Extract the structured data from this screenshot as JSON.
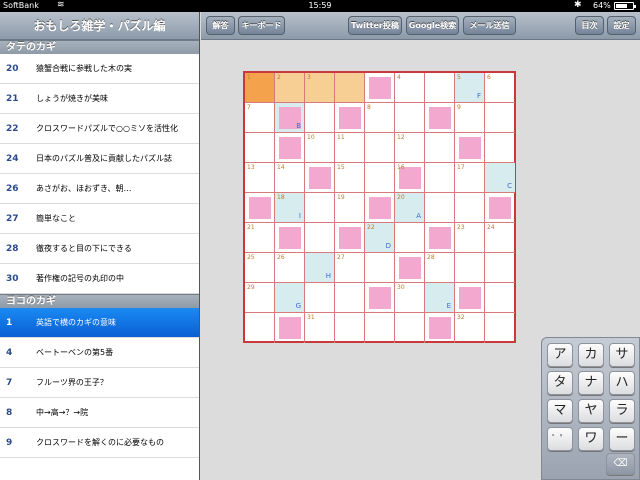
{
  "status": {
    "carrier": "SoftBank",
    "time": "15:59",
    "battery": "64%"
  },
  "sidebar": {
    "title": "おもしろ雑学・パズル編",
    "down_header": "タテのカギ",
    "down": [
      {
        "num": "20",
        "text": "猿蟹合戦に参戦した木の実"
      },
      {
        "num": "21",
        "text": "しょうが焼きが美味"
      },
      {
        "num": "22",
        "text": "クロスワードパズルで○○ミソを活性化"
      },
      {
        "num": "24",
        "text": "日本のパズル普及に貢献したパズル誌"
      },
      {
        "num": "26",
        "text": "あさがお、ほおずき、朝…"
      },
      {
        "num": "27",
        "text": "簡単なこと"
      },
      {
        "num": "28",
        "text": "徹夜すると目の下にできる"
      },
      {
        "num": "30",
        "text": "著作権の記号の丸印の中"
      }
    ],
    "across_header": "ヨコのカギ",
    "across": [
      {
        "num": "1",
        "text": "英語で横のカギの意味"
      },
      {
        "num": "4",
        "text": "ベートーベンの第5番"
      },
      {
        "num": "7",
        "text": "フルーツ界の王子？"
      },
      {
        "num": "8",
        "text": "中→高→？→院"
      },
      {
        "num": "9",
        "text": "クロスワードを解くのに必要なもの"
      }
    ]
  },
  "toolbar": {
    "answer": "解答",
    "keyboard": "キーボード",
    "twitter": "Twitter投稿",
    "google": "Google検索",
    "mail": "メール送信",
    "contents": "目次",
    "settings": "設定"
  },
  "grid": {
    "numbers": [
      {
        "r": 0,
        "c": 0,
        "n": "1"
      },
      {
        "r": 0,
        "c": 1,
        "n": "2"
      },
      {
        "r": 0,
        "c": 2,
        "n": "3"
      },
      {
        "r": 0,
        "c": 5,
        "n": "4"
      },
      {
        "r": 0,
        "c": 7,
        "n": "5"
      },
      {
        "r": 0,
        "c": 8,
        "n": "6"
      },
      {
        "r": 1,
        "c": 0,
        "n": "7"
      },
      {
        "r": 1,
        "c": 4,
        "n": "8"
      },
      {
        "r": 1,
        "c": 7,
        "n": "9"
      },
      {
        "r": 2,
        "c": 2,
        "n": "10"
      },
      {
        "r": 2,
        "c": 3,
        "n": "11"
      },
      {
        "r": 2,
        "c": 5,
        "n": "12"
      },
      {
        "r": 3,
        "c": 0,
        "n": "13"
      },
      {
        "r": 3,
        "c": 1,
        "n": "14"
      },
      {
        "r": 3,
        "c": 3,
        "n": "15"
      },
      {
        "r": 3,
        "c": 5,
        "n": "16"
      },
      {
        "r": 3,
        "c": 7,
        "n": "17"
      },
      {
        "r": 4,
        "c": 1,
        "n": "18"
      },
      {
        "r": 4,
        "c": 3,
        "n": "19"
      },
      {
        "r": 4,
        "c": 5,
        "n": "20"
      },
      {
        "r": 5,
        "c": 0,
        "n": "21"
      },
      {
        "r": 5,
        "c": 4,
        "n": "22"
      },
      {
        "r": 5,
        "c": 7,
        "n": "23"
      },
      {
        "r": 5,
        "c": 8,
        "n": "24"
      },
      {
        "r": 6,
        "c": 0,
        "n": "25"
      },
      {
        "r": 6,
        "c": 1,
        "n": "26"
      },
      {
        "r": 6,
        "c": 3,
        "n": "27"
      },
      {
        "r": 6,
        "c": 6,
        "n": "28"
      },
      {
        "r": 7,
        "c": 0,
        "n": "29"
      },
      {
        "r": 7,
        "c": 5,
        "n": "30"
      },
      {
        "r": 8,
        "c": 2,
        "n": "31"
      },
      {
        "r": 8,
        "c": 7,
        "n": "32"
      }
    ],
    "letters": [
      {
        "r": 0,
        "c": 7,
        "l": "F"
      },
      {
        "r": 1,
        "c": 1,
        "l": "B"
      },
      {
        "r": 3,
        "c": 8,
        "l": "C"
      },
      {
        "r": 4,
        "c": 1,
        "l": "I"
      },
      {
        "r": 4,
        "c": 5,
        "l": "A"
      },
      {
        "r": 5,
        "c": 4,
        "l": "D"
      },
      {
        "r": 6,
        "c": 2,
        "l": "H"
      },
      {
        "r": 7,
        "c": 1,
        "l": "G"
      },
      {
        "r": 7,
        "c": 6,
        "l": "E"
      }
    ]
  },
  "keyboard": {
    "keys": [
      "ア",
      "カ",
      "サ",
      "タ",
      "ナ",
      "ハ",
      "マ",
      "ヤ",
      "ラ",
      "゛゜",
      "ワ",
      "ー",
      "⌫"
    ]
  }
}
